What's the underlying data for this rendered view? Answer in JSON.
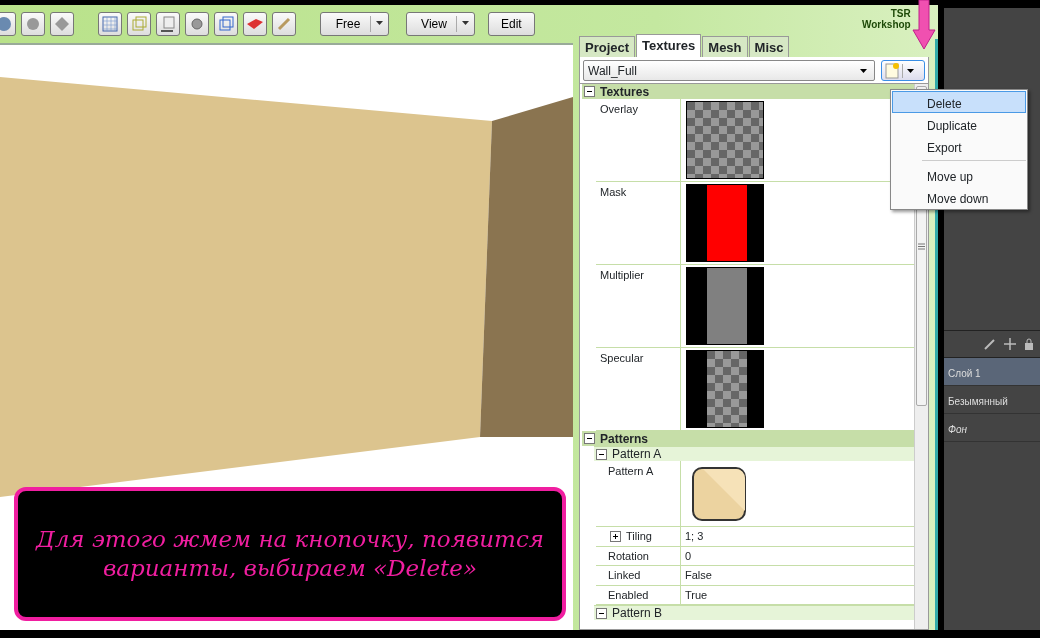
{
  "toolbar": {
    "dropdowns": [
      {
        "label": "Free"
      },
      {
        "label": "View"
      }
    ],
    "button": "Edit"
  },
  "logo": {
    "line1": "TSR",
    "line2": "Workshop"
  },
  "tabs": [
    {
      "label": "Project",
      "selected": false
    },
    {
      "label": "Textures",
      "selected": true
    },
    {
      "label": "Mesh",
      "selected": false
    },
    {
      "label": "Misc",
      "selected": false
    }
  ],
  "texture_select": {
    "value": "Wall_Full"
  },
  "menu": [
    {
      "label": "Delete",
      "selected": true,
      "separator_before": false
    },
    {
      "label": "Duplicate",
      "selected": false,
      "separator_before": false
    },
    {
      "label": "Export",
      "selected": false,
      "separator_before": false
    },
    {
      "label": "Move up",
      "selected": false,
      "separator_before": true
    },
    {
      "label": "Move down",
      "selected": false,
      "separator_before": false
    }
  ],
  "properties": [
    {
      "title": "Textures",
      "expanded": true,
      "children": [
        {
          "kind": "checker",
          "label": "Overlay"
        },
        {
          "kind": "red-mask",
          "label": "Mask"
        },
        {
          "kind": "gray-mask",
          "label": "Multiplier"
        },
        {
          "kind": "checker-mask",
          "label": "Specular"
        }
      ]
    },
    {
      "title": "Patterns",
      "expanded": true,
      "children": [
        {
          "kind": "group",
          "title": "Pattern A",
          "expanded": true,
          "children": [
            {
              "kind": "pattern",
              "label": "Pattern A"
            },
            {
              "kind": "value",
              "label": "Tiling",
              "value": "1; 3",
              "expanded": false
            },
            {
              "kind": "value",
              "label": "Rotation",
              "value": "0"
            },
            {
              "kind": "value",
              "label": "Linked",
              "value": "False"
            },
            {
              "kind": "value",
              "label": "Enabled",
              "value": "True"
            }
          ]
        },
        {
          "kind": "group",
          "title": "Pattern B",
          "expanded": true
        }
      ]
    }
  ],
  "layers": [
    {
      "name": "Слой 1",
      "selected": true,
      "kind": "layer"
    },
    {
      "name": "Безымянный",
      "selected": false,
      "kind": "layer"
    },
    {
      "name": "Фон",
      "selected": false,
      "kind": "background"
    }
  ],
  "caption": "Для этого жмем на кнопочку, появится варианты, выбираем «Delete»"
}
